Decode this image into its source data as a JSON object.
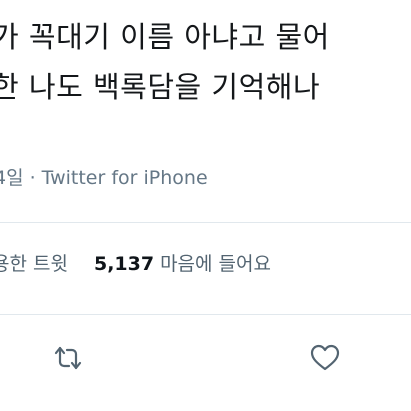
{
  "tweet": {
    "text_line1": "가 꼭대기 이름 아냐고 물어",
    "text_line2": "한 나도 백록담을 기억해나",
    "date_fragment": "4일",
    "separator": "·",
    "source": "Twitter for iPhone"
  },
  "stats": {
    "quote_label": "용한 트윗",
    "likes_count": "5,137",
    "likes_label": "마음에 들어요"
  },
  "actions": {
    "retweet_icon": "retweet-icon",
    "like_icon": "heart-icon",
    "icon_color": "#536471"
  }
}
